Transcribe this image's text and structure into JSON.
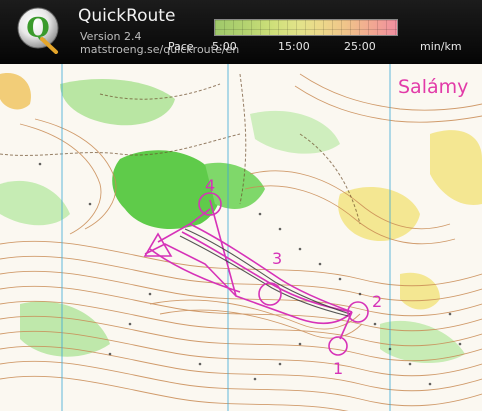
{
  "app": {
    "title": "QuickRoute",
    "version": "Version 2.4",
    "url": "matstroeng.se/quickroute/en",
    "logo_letter": "Q"
  },
  "pace_scale": {
    "label": "Pace",
    "ticks": [
      "5:00",
      "15:00",
      "25:00"
    ],
    "unit": "min/km"
  },
  "map": {
    "title": "Salámy",
    "controls": [
      "1",
      "2",
      "3",
      "4"
    ],
    "colors": {
      "route": "#d632b8",
      "forest_green": "#5fcb4a",
      "light_green": "#b9e6a3",
      "yellow": "#f3e27a",
      "contour": "#c98b54",
      "meridian": "#3aa7d6"
    }
  }
}
